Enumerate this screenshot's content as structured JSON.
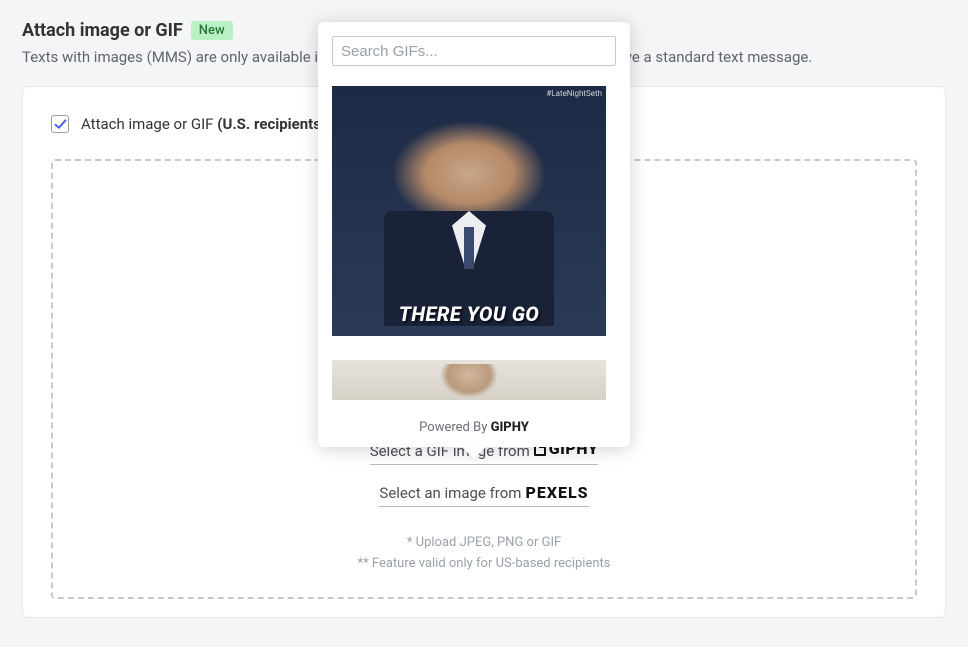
{
  "header": {
    "title": "Attach image or GIF",
    "badge": "New",
    "subhead": "Texts with images (MMS) are only available in the U.S. Non-U.S. based customers will receive a standard text message."
  },
  "checkbox": {
    "checked": true,
    "label_prefix": "Attach image or GIF ",
    "label_bold": "(U.S. recipients only)"
  },
  "dropzone": {
    "giphy_link_prefix": "Select a GIF image from",
    "giphy_brand": "GIPHY",
    "pexels_link_prefix": "Select an image from",
    "pexels_brand": "PEXELS",
    "footnote1": "* Upload JPEG, PNG or GIF",
    "footnote2": "** Feature valid only for US-based recipients"
  },
  "popover": {
    "search_placeholder": "Search GIFs...",
    "gif1_caption": "THERE YOU GO",
    "gif1_watermark": "#LateNightSeth",
    "powered_prefix": "Powered By ",
    "powered_brand": "GIPHY"
  }
}
